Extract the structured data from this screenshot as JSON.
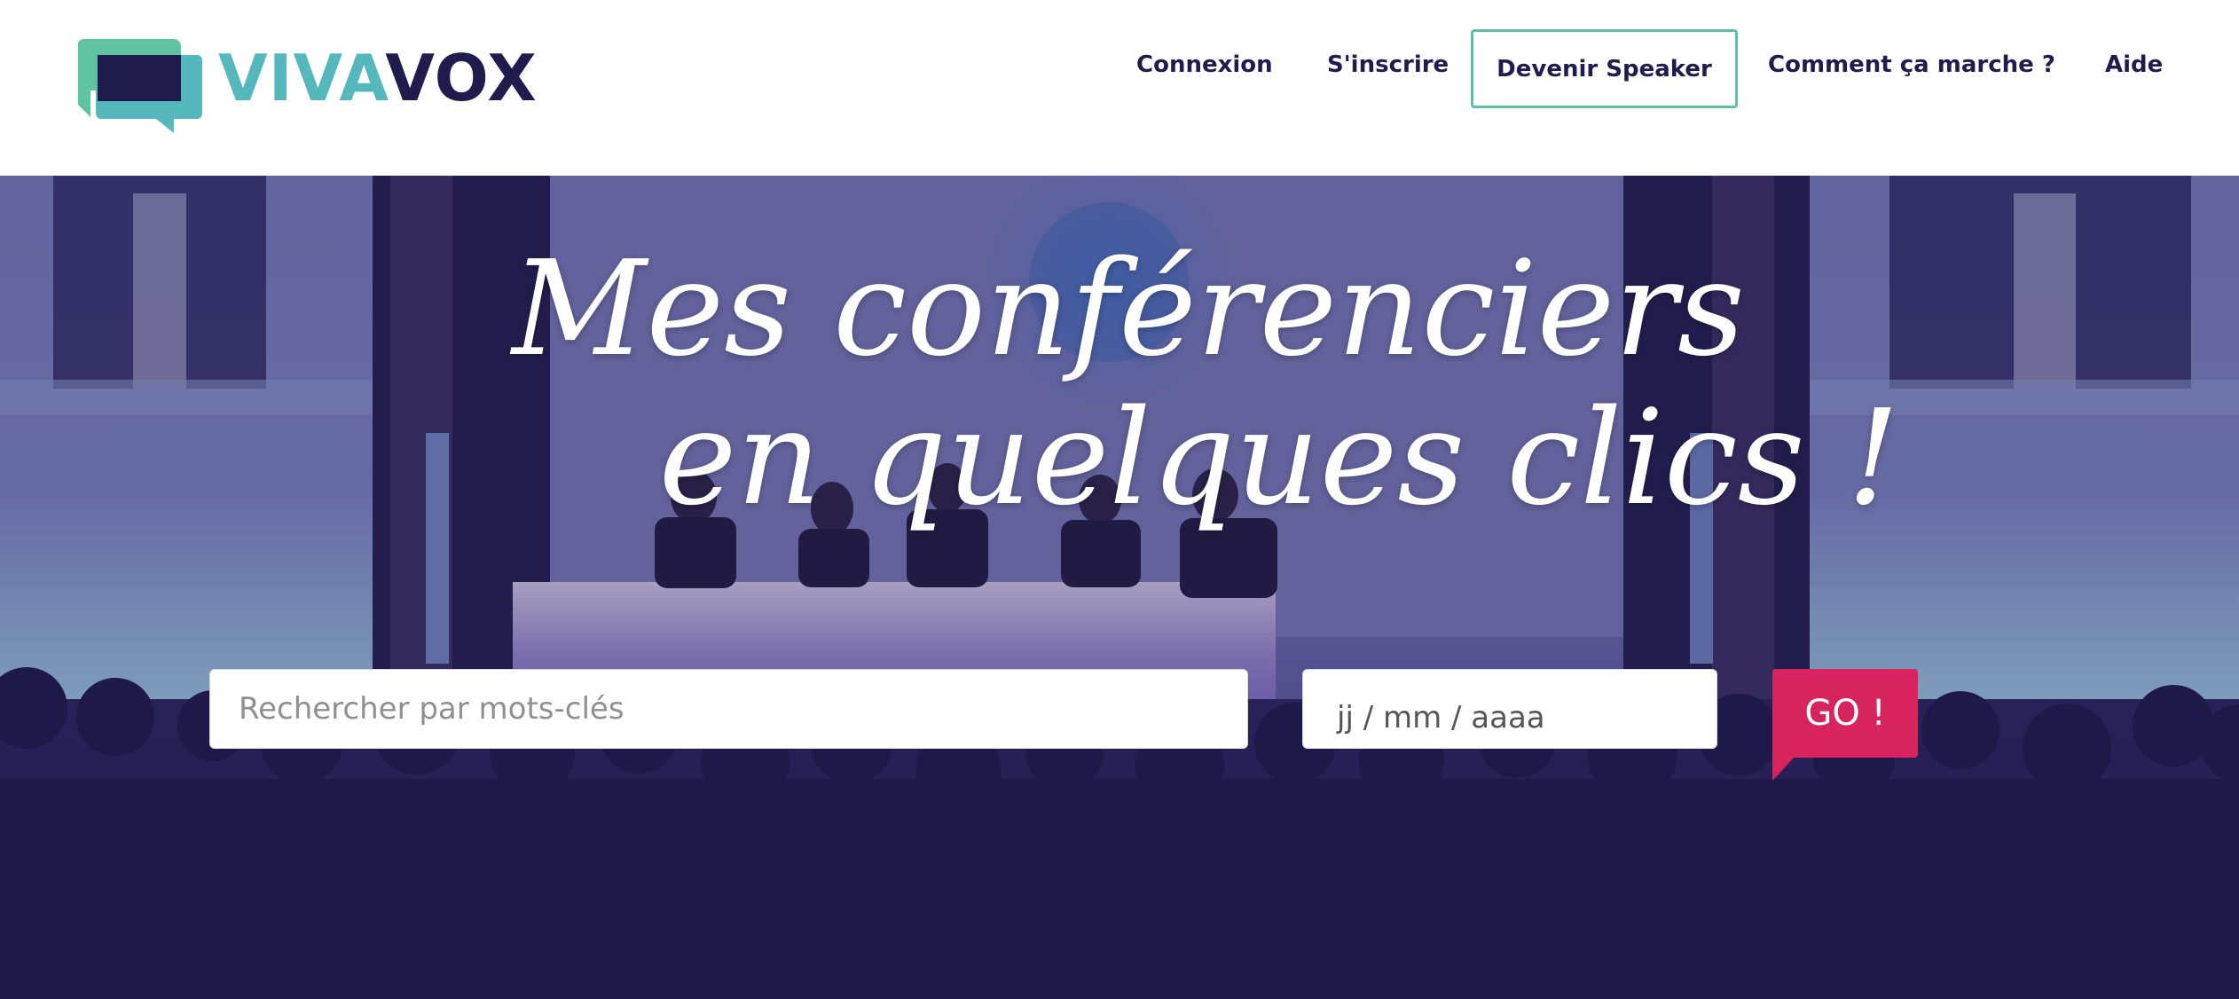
{
  "brand": {
    "name_part1": "VIVA",
    "name_part2": "VOX",
    "colors": {
      "teal": "#55b8bd",
      "navy": "#201c4e",
      "green_border": "#5fbfa6",
      "go_red": "#d7245e"
    }
  },
  "nav": {
    "login": "Connexion",
    "signup": "S'inscrire",
    "become_speaker": "Devenir Speaker",
    "how_it_works": "Comment ça marche ?",
    "help": "Aide"
  },
  "hero": {
    "headline_line1": "Mes conférenciers",
    "headline_line2": "en quelques clics !",
    "search_placeholder": "Rechercher par mots-clés",
    "date_placeholder": "jj / mm / aaaa",
    "go_label": "GO !"
  }
}
